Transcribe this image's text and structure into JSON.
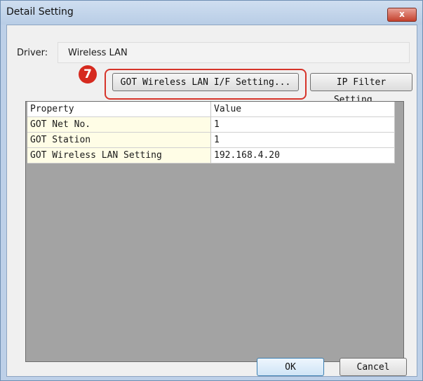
{
  "window": {
    "title": "Detail Setting",
    "close_label": "x"
  },
  "driver": {
    "label": "Driver:",
    "value": "Wireless LAN"
  },
  "annotation": {
    "step_number": "7",
    "highlight_color": "#d6342a"
  },
  "buttons": {
    "got_wireless_lan": "GOT Wireless LAN I/F Setting...",
    "ip_filter": "IP Filter Setting...",
    "ok": "OK",
    "cancel": "Cancel"
  },
  "table": {
    "headers": [
      "Property",
      "Value"
    ],
    "rows": [
      {
        "property": "GOT Net No.",
        "value": "1"
      },
      {
        "property": "GOT Station",
        "value": "1"
      },
      {
        "property": "GOT Wireless LAN Setting",
        "value": "192.168.4.20"
      }
    ]
  }
}
